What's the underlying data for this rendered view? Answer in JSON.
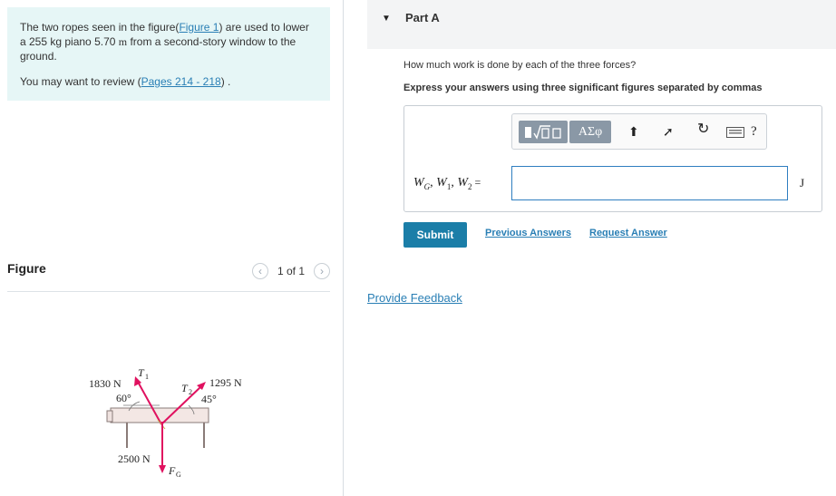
{
  "problem": {
    "text_before_link": "The two ropes seen in the figure(",
    "figure_link": "Figure 1",
    "text_after_link": ") are used to lower a 255 kg piano 5.70 ",
    "unit_m": "m",
    "text_end": " from a second-story window to the ground.",
    "review_before": "You may want to review (",
    "review_link": "Pages 214 - 218",
    "review_after": ") ."
  },
  "figure": {
    "title": "Figure",
    "pager_text": "1 of 1",
    "prev_icon": "chevron-left-icon",
    "next_icon": "chevron-right-icon",
    "labels": {
      "force1": "1830 N",
      "angle1": "60°",
      "t1": "T",
      "t1_sub": "1",
      "t2": "T",
      "t2_sub": "2",
      "force2": "1295 N",
      "angle2": "45°",
      "weight": "2500 N",
      "fg": "F",
      "fg_sub": "G"
    }
  },
  "part": {
    "caret_icon": "caret-down-icon",
    "title": "Part A",
    "question": "How much work is done by each of the three forces?",
    "instruction": "Express your answers using three significant figures separated by commas",
    "toolbar": {
      "template_icon": "template-icon",
      "greek_label": "ΑΣφ",
      "undo_icon": "undo-icon",
      "redo_icon": "redo-icon",
      "reset_icon": "reset-icon",
      "keyboard_icon": "keyboard-icon",
      "help_label": "?"
    },
    "var_label": "W",
    "var_sub_g": "G",
    "var_w1": "W",
    "var_sub_1": "1",
    "var_w2": "W",
    "var_sub_2": "2",
    "input_value": "",
    "unit": "J",
    "submit_label": "Submit",
    "previous_answers": "Previous Answers",
    "request_answer": "Request Answer"
  },
  "feedback_label": "Provide Feedback",
  "colors": {
    "accent": "#2a7fb5",
    "submit": "#1b7ea8",
    "arrow": "#e0115f",
    "problem_bg": "#e6f6f6"
  }
}
